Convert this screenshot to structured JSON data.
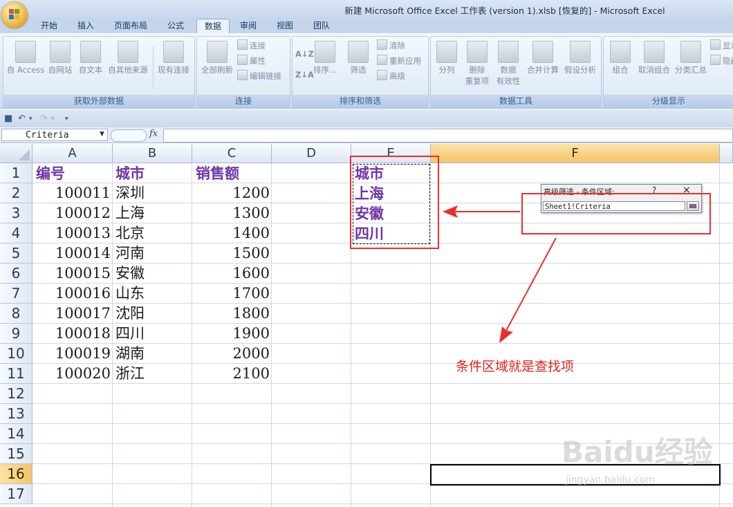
{
  "window": {
    "title": "新建 Microsoft Office Excel 工作表 (version 1).xlsb [恢复的] - Microsoft Excel"
  },
  "tabs": [
    "开始",
    "插入",
    "页面布局",
    "公式",
    "数据",
    "审阅",
    "视图",
    "团队"
  ],
  "active_tab": "数据",
  "ribbon": {
    "groups": [
      {
        "label": "获取外部数据",
        "buttons": [
          "自 Access",
          "自网站",
          "自文本",
          "自其他来源",
          "现有连接"
        ]
      },
      {
        "label": "连接",
        "buttons": [
          "全部刷新"
        ],
        "small": [
          "连接",
          "属性",
          "编辑链接"
        ]
      },
      {
        "label": "排序和筛选",
        "buttons": [
          "排序...",
          "筛选"
        ],
        "small": [
          "清除",
          "重新应用",
          "高级"
        ]
      },
      {
        "label": "数据工具",
        "buttons": [
          "分列",
          "删除\n重复项",
          "数据\n有效性",
          "合并计算",
          "假设分析"
        ]
      },
      {
        "label": "分级显示",
        "buttons": [
          "组合",
          "取消组合",
          "分类汇总"
        ],
        "small": [
          "显示",
          "隐藏"
        ]
      }
    ]
  },
  "formula_bar": {
    "name_box": "Criteria",
    "fx": "fx",
    "formula": ""
  },
  "columns": [
    "A",
    "B",
    "C",
    "D",
    "E",
    "F"
  ],
  "selected_column": "F",
  "rows": [
    "1",
    "2",
    "3",
    "4",
    "5",
    "6",
    "7",
    "8",
    "9",
    "10",
    "11",
    "12",
    "13",
    "14",
    "15",
    "16",
    "17"
  ],
  "selected_row": "16",
  "sheet": {
    "header": [
      "编号",
      "城市",
      "销售额"
    ],
    "data": [
      [
        "100011",
        "深圳",
        "1200"
      ],
      [
        "100012",
        "上海",
        "1300"
      ],
      [
        "100013",
        "北京",
        "1400"
      ],
      [
        "100014",
        "河南",
        "1500"
      ],
      [
        "100015",
        "安徽",
        "1600"
      ],
      [
        "100016",
        "山东",
        "1700"
      ],
      [
        "100017",
        "沈阳",
        "1800"
      ],
      [
        "100018",
        "四川",
        "1900"
      ],
      [
        "100019",
        "湖南",
        "2000"
      ],
      [
        "100020",
        "浙江",
        "2100"
      ]
    ],
    "criteria": [
      "城市",
      "上海",
      "安徽",
      "四川"
    ]
  },
  "dialog": {
    "title": "高级筛选 - 条件区域:",
    "help": "?",
    "close": "×",
    "value": "Sheet1!Criteria"
  },
  "annotation": "条件区域就是查找项",
  "watermark": {
    "main": "Baidu经验",
    "sub": "jingyan.baidu.com"
  },
  "colors": {
    "header_text": "#6f35a5",
    "annotation_red": "#ee2c2c",
    "selected_header": "#f5c46b"
  }
}
